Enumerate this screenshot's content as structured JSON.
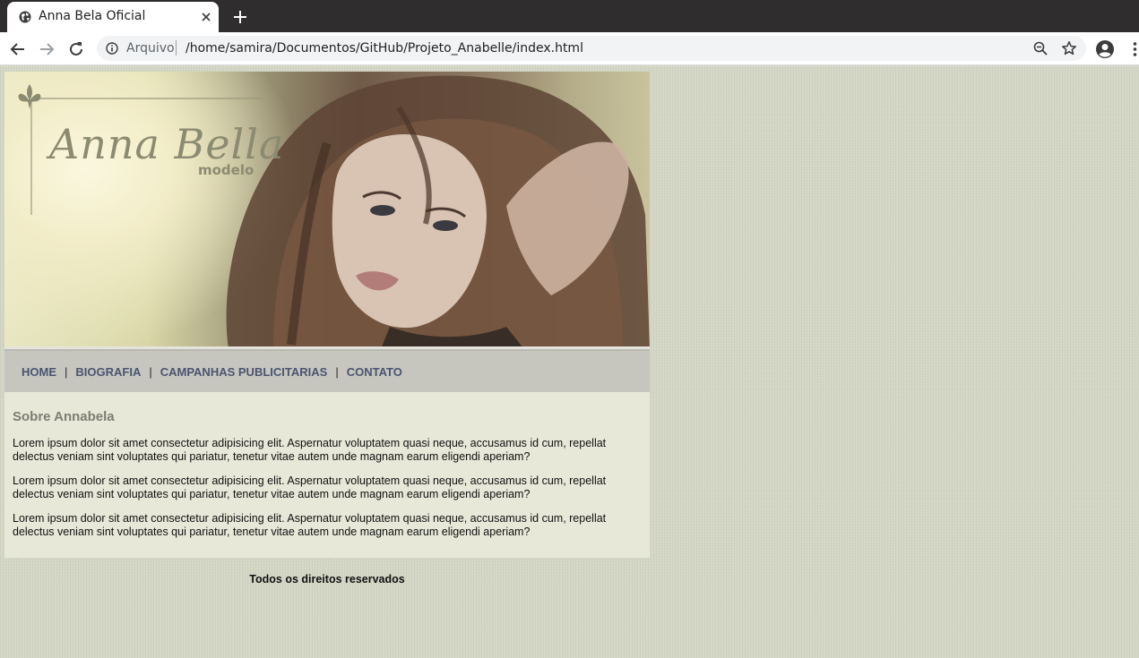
{
  "browser": {
    "tab": {
      "title": "Anna Bela Oficial",
      "favicon": "globe-icon",
      "close_icon": "close-icon"
    },
    "new_tab_icon": "plus-icon",
    "toolbar": {
      "back_icon": "arrow-left-icon",
      "forward_icon": "arrow-right-icon",
      "reload_icon": "reload-icon",
      "scheme_label": "Arquivo",
      "url": "/home/samira/Documentos/GitHub/Projeto_Anabelle/index.html",
      "zoom_icon": "zoom-out-icon",
      "bookmark_icon": "star-icon",
      "profile_icon": "account-icon",
      "menu_icon": "vertical-dots-icon"
    }
  },
  "site": {
    "logo": {
      "name": "Anna Bella",
      "subtitle": "modelo",
      "emblem": "fleur-de-lis-icon"
    },
    "nav": {
      "items": [
        {
          "label": "HOME"
        },
        {
          "label": "BIOGRAFIA"
        },
        {
          "label": "CAMPANHAS PUBLICITARIAS"
        },
        {
          "label": "CONTATO"
        }
      ],
      "separator": "|"
    },
    "content": {
      "heading": "Sobre Annabela",
      "paragraphs": [
        "Lorem ipsum dolor sit amet consectetur adipisicing elit. Aspernatur voluptatem quasi neque, accusamus id cum, repellat delectus veniam sint voluptates qui pariatur, tenetur vitae autem unde magnam earum eligendi aperiam?",
        "Lorem ipsum dolor sit amet consectetur adipisicing elit. Aspernatur voluptatem quasi neque, accusamus id cum, repellat delectus veniam sint voluptates qui pariatur, tenetur vitae autem unde magnam earum eligendi aperiam?",
        "Lorem ipsum dolor sit amet consectetur adipisicing elit. Aspernatur voluptatem quasi neque, accusamus id cum, repellat delectus veniam sint voluptates qui pariatur, tenetur vitae autem unde magnam earum eligendi aperiam?"
      ]
    },
    "footer": {
      "text": "Todos os direitos reservados"
    }
  },
  "colors": {
    "page_background": "#d4d7c5",
    "nav_background": "#c6c6bf",
    "nav_link": "#4a5470",
    "content_background": "#e7e8d8",
    "heading": "#7d7d72",
    "logo": "#8b8b72"
  }
}
